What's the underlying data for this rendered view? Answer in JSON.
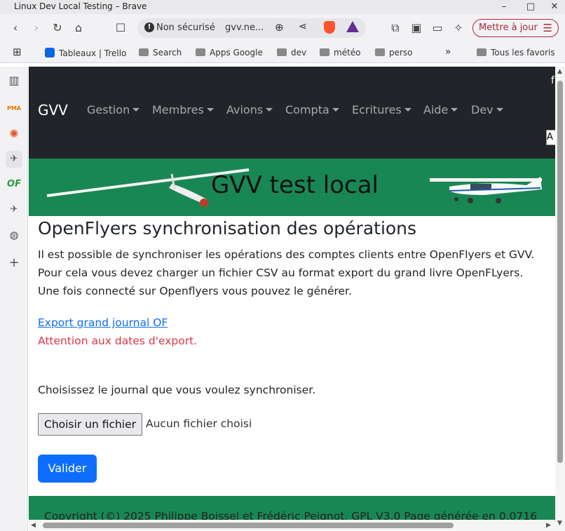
{
  "window": {
    "title": "Linux Dev Local Testing – Brave"
  },
  "toolbar": {
    "security_label": "Non sécurisé",
    "url_host": "gvv.ne...",
    "update_label": "Mettre à jour"
  },
  "bookmarks": {
    "items": [
      {
        "label": "Tableaux | Trello",
        "icon": "trello-icon"
      },
      {
        "label": "Search",
        "icon": "folder-icon"
      },
      {
        "label": "Apps Google",
        "icon": "folder-icon"
      },
      {
        "label": "dev",
        "icon": "folder-icon"
      },
      {
        "label": "météo",
        "icon": "folder-icon"
      },
      {
        "label": "perso",
        "icon": "folder-icon"
      }
    ],
    "overflow": "»",
    "all_label": "Tous les favoris"
  },
  "navbar": {
    "brand": "GVV",
    "items": [
      "Gestion",
      "Membres",
      "Avions",
      "Compta",
      "Ecritures",
      "Aide",
      "Dev"
    ],
    "right_char": "f",
    "right_box": "A"
  },
  "banner": {
    "title": "GVV test local"
  },
  "page": {
    "heading": "OpenFlyers synchronisation des opérations",
    "intro_lines": [
      "Il est possible de synchroniser les opérations des comptes clients entre OpenFlyers et GVV.",
      "Pour cela vous devez charger un fichier CSV au format export du grand livre OpenFLyers.",
      "Une fois connecté sur Openflyers vous pouvez le générer."
    ],
    "export_link": "Export grand journal OF",
    "warning": "Attention aux dates d'export.",
    "choose_prompt": "Choisissez le journal que vous voulez synchroniser.",
    "file_button": "Choisir un fichier",
    "file_status": "Aucun fichier choisi",
    "submit": "Valider"
  },
  "footer": {
    "text": "Copyright (©) 2025 Philippe Boissel et Frédéric Peignot, GPL V3.0 Page générée en 0.0716"
  },
  "colors": {
    "navbar": "#212529",
    "banner": "#198754",
    "primary": "#0d6efd",
    "danger": "#dc3545",
    "update": "#b0273a"
  }
}
